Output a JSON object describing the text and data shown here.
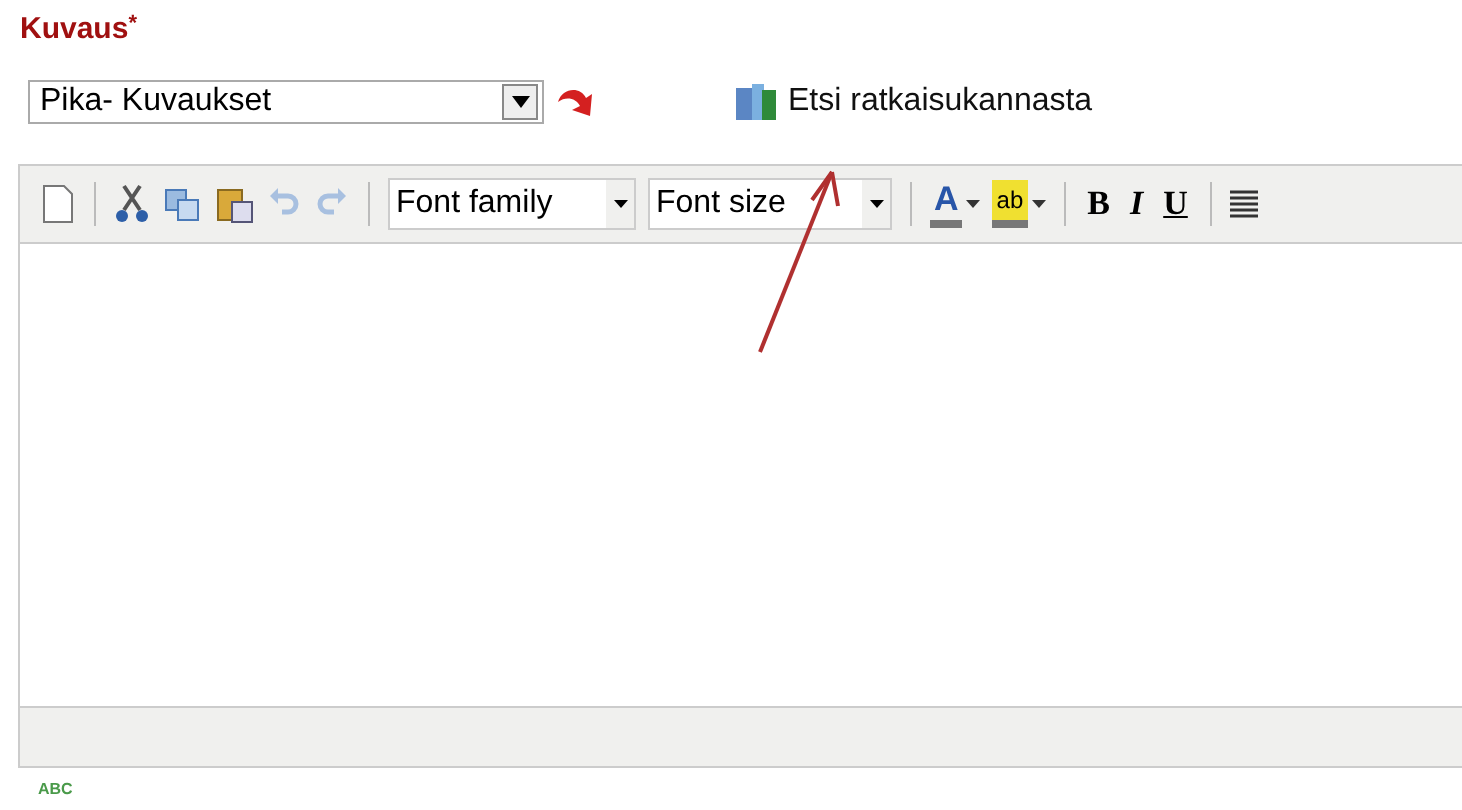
{
  "field_label": {
    "text": "Kuvaus",
    "required_mark": "*"
  },
  "quick_select": {
    "value": "Pika- Kuvaukset"
  },
  "search_link": "Etsi ratkaisukannasta",
  "toolbar": {
    "font_family": "Font family",
    "font_size": "Font size",
    "font_color_letter": "A",
    "highlight_letters": "ab",
    "bold": "B",
    "italic": "I",
    "underline": "U"
  },
  "spellcheck_label": "ABC"
}
